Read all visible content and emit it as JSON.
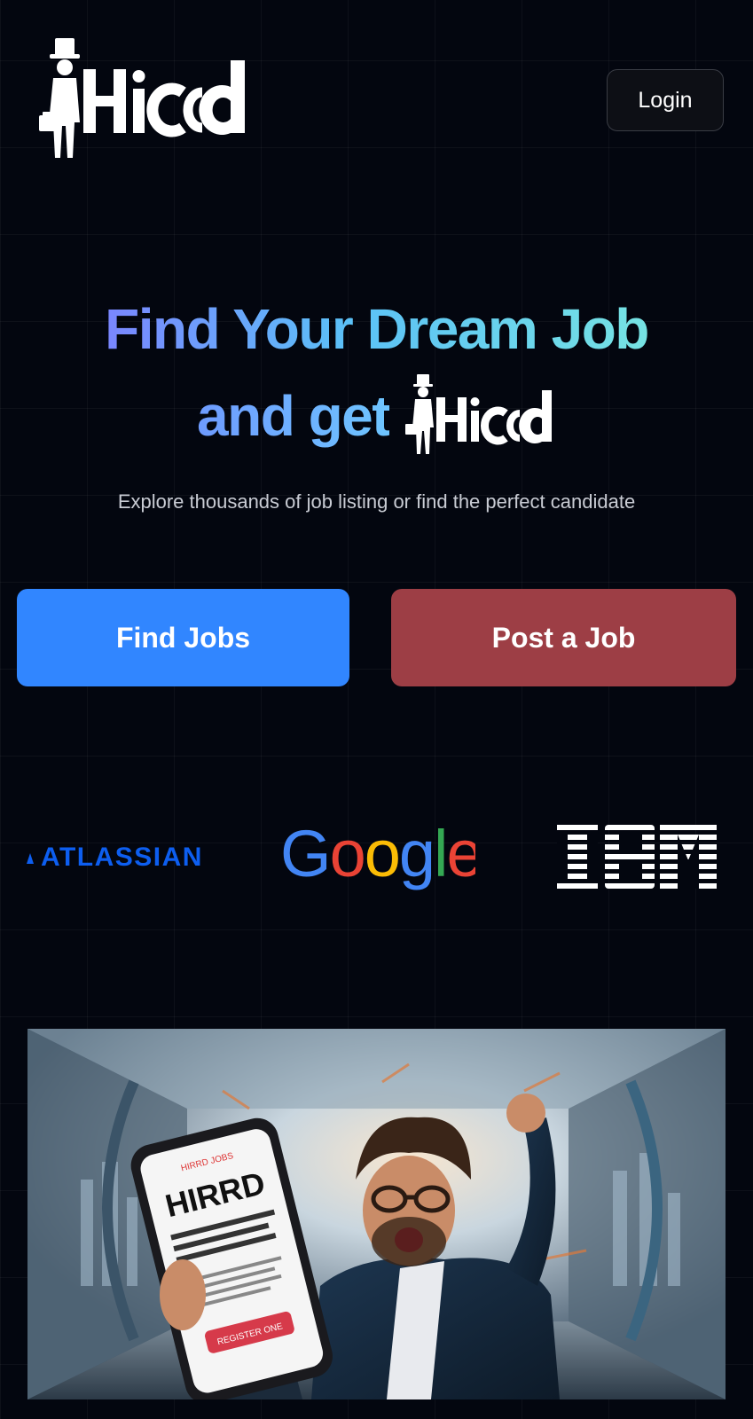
{
  "header": {
    "logo_text": "Hirrd",
    "login_label": "Login"
  },
  "hero": {
    "title_line1": "Find Your Dream Job",
    "title_line2": "and get",
    "subtitle": "Explore thousands of job listing or find the perfect candidate",
    "find_jobs_label": "Find Jobs",
    "post_job_label": "Post a Job"
  },
  "companies": [
    {
      "name": "ATLASSIAN"
    },
    {
      "name": "Google"
    },
    {
      "name": "IBM"
    }
  ],
  "banner": {
    "phone_brand": "HIRRD",
    "phone_small_label": "HIRRD JOBS",
    "phone_button": "REGISTER ONE"
  },
  "colors": {
    "background": "#03060f",
    "find_jobs": "#3186ff",
    "post_job": "#9d3e45",
    "gradient_start": "#7a86ff",
    "gradient_end": "#76e3e3"
  }
}
